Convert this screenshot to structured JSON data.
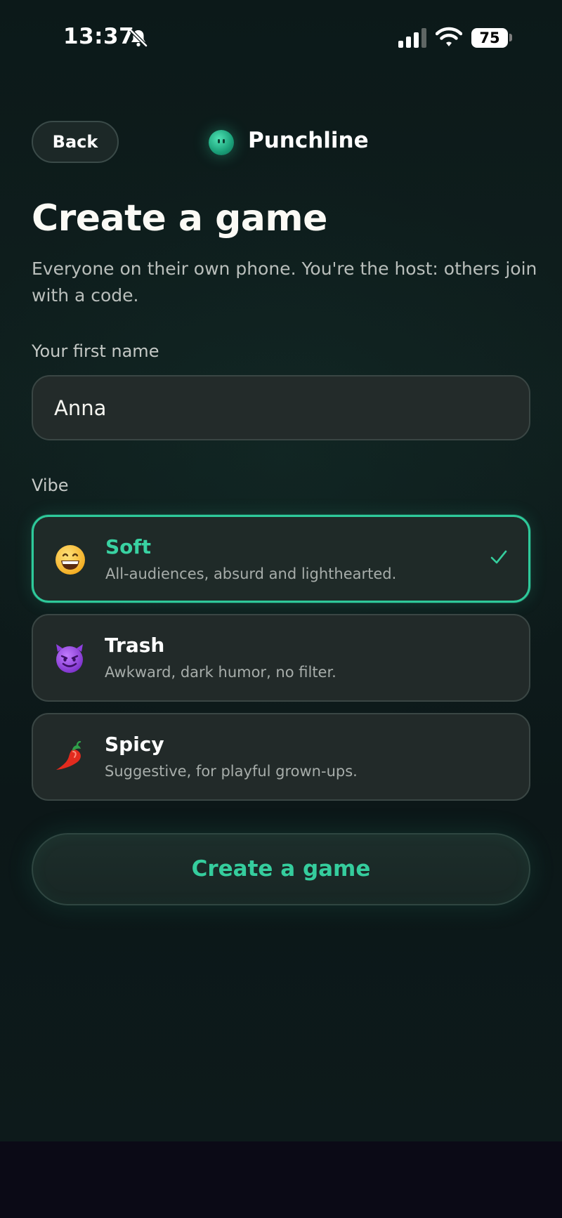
{
  "status_bar": {
    "time": "13:37",
    "battery": "75",
    "icons": [
      "bell-slash-icon",
      "cellular-signal-icon",
      "wifi-icon",
      "battery-icon"
    ]
  },
  "header": {
    "back_label": "Back",
    "brand_name": "Punchline",
    "brand_icon": "punchline-logo-icon"
  },
  "page": {
    "title": "Create a game",
    "subtitle": "Everyone on their own phone. You're the host: others join with a code."
  },
  "name_field": {
    "label": "Your first name",
    "value": "Anna"
  },
  "vibe": {
    "label": "Vibe",
    "selected": "Soft",
    "options": [
      {
        "title": "Soft",
        "description": "All-audiences, absurd and lighthearted.",
        "icon": "grinning-face-emoji",
        "selected": true
      },
      {
        "title": "Trash",
        "description": "Awkward, dark humor, no filter.",
        "icon": "smiling-devil-emoji",
        "selected": false
      },
      {
        "title": "Spicy",
        "description": "Suggestive, for playful grown-ups.",
        "icon": "chili-pepper-emoji",
        "selected": false
      }
    ]
  },
  "create_button": {
    "label": "Create a game"
  },
  "colors": {
    "accent": "#2ec99a",
    "background": "#0f1f1e",
    "card": "#222a29",
    "text": "#f2f2ee",
    "muted_text": "#a7adaa"
  }
}
